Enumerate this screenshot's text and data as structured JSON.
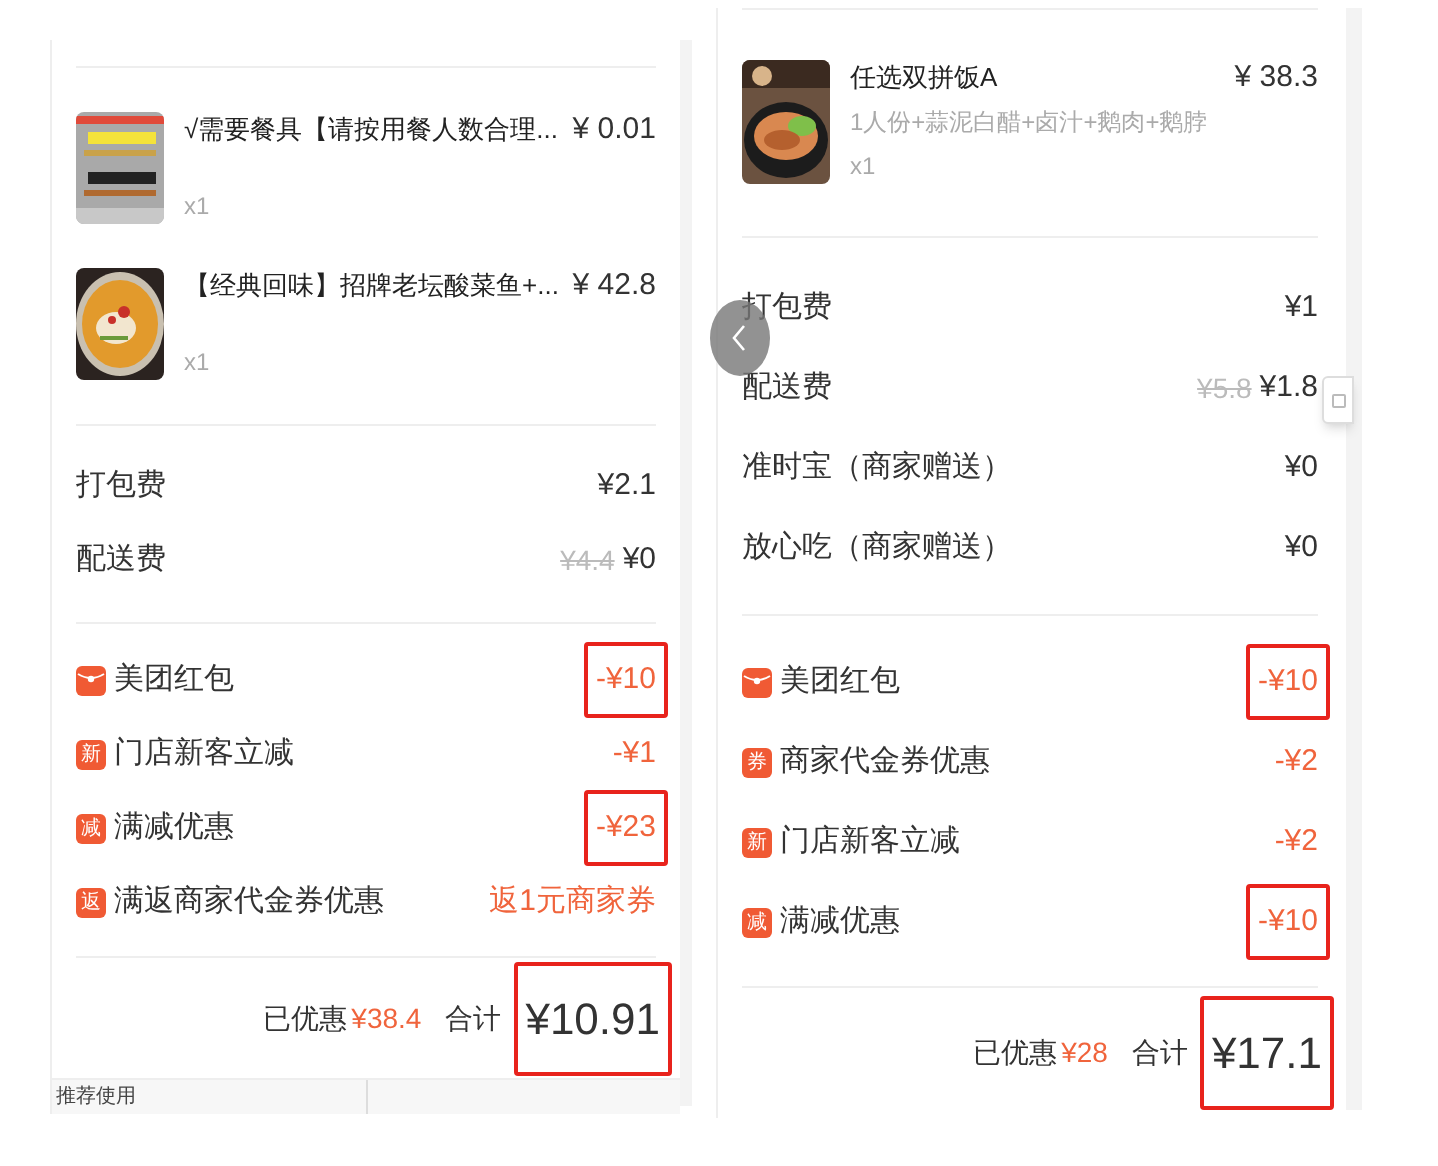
{
  "panels": [
    {
      "items": [
        {
          "name": "√需要餐具【请按用餐人数合理...",
          "quantity": "x1",
          "price": "¥ 0.01",
          "kind": "picture"
        },
        {
          "name": "【经典回味】招牌老坛酸菜鱼+...",
          "quantity": "x1",
          "price": "¥ 42.8",
          "kind": "picture"
        }
      ],
      "fees": [
        {
          "label": "打包费",
          "value": "¥2.1"
        },
        {
          "label": "配送费",
          "original": "¥4.4",
          "value": "¥0"
        }
      ],
      "discounts": [
        {
          "kind": "envelope",
          "label": "美团红包",
          "value": "-¥10",
          "highlighted": true
        },
        {
          "kind": "badge",
          "badge": "新",
          "label": "门店新客立减",
          "value": "-¥1",
          "highlighted": false
        },
        {
          "kind": "badge",
          "badge": "减",
          "label": "满减优惠",
          "value": "-¥23",
          "highlighted": true
        },
        {
          "kind": "badge",
          "badge": "返",
          "label": "满返商家代金券优惠",
          "value": "返1元商家券",
          "highlighted": false
        }
      ],
      "summary": {
        "saved_label": "已优惠",
        "saved": "¥38.4",
        "total_label": "合计",
        "total": "¥10.91",
        "highlighted": true
      },
      "recommend_label": "推荐使用"
    },
    {
      "items": [
        {
          "name": "任选双拼饭A",
          "specs": "1人份+蒜泥白醋+卤汁+鹅肉+鹅脖",
          "quantity": "x1",
          "price": "¥ 38.3",
          "kind": "picture"
        }
      ],
      "fees": [
        {
          "label": "打包费",
          "value": "¥1"
        },
        {
          "label": "配送费",
          "original": "¥5.8",
          "value": "¥1.8"
        },
        {
          "label": "准时宝（商家赠送）",
          "value": "¥0"
        },
        {
          "label": "放心吃（商家赠送）",
          "value": "¥0"
        }
      ],
      "discounts": [
        {
          "kind": "envelope",
          "label": "美团红包",
          "value": "-¥10",
          "highlighted": true
        },
        {
          "kind": "badge",
          "badge": "券",
          "label": "商家代金券优惠",
          "value": "-¥2",
          "highlighted": false
        },
        {
          "kind": "badge",
          "badge": "新",
          "label": "门店新客立减",
          "value": "-¥2",
          "highlighted": false
        },
        {
          "kind": "badge",
          "badge": "减",
          "label": "满减优惠",
          "value": "-¥10",
          "highlighted": true
        }
      ],
      "summary": {
        "saved_label": "已优惠",
        "saved": "¥28",
        "total_label": "合计",
        "total": "¥17.1",
        "highlighted": true
      }
    }
  ]
}
